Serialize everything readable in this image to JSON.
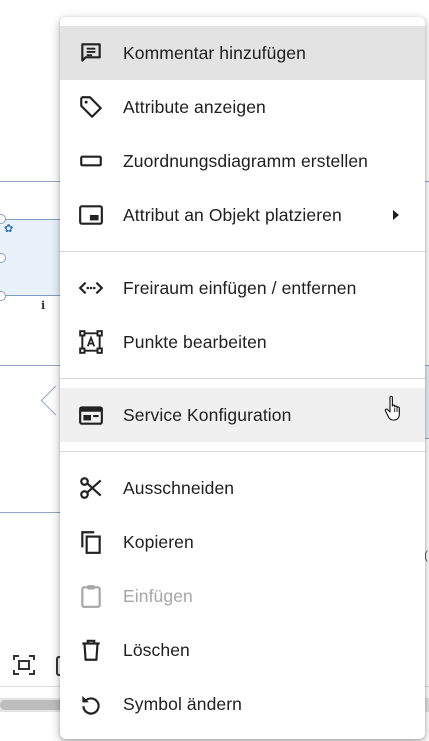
{
  "context_menu": {
    "groups": [
      [
        {
          "label": "Kommentar hinzufügen",
          "icon": "comment-icon",
          "state": "highlighted"
        },
        {
          "label": "Attribute anzeigen",
          "icon": "tag-icon"
        },
        {
          "label": "Zuordnungsdiagramm erstellen",
          "icon": "rectangle-outline-icon"
        },
        {
          "label": "Attribut an Objekt platzieren",
          "icon": "picture-in-picture-icon",
          "submenu": true
        }
      ],
      [
        {
          "label": "Freiraum einfügen / entfernen",
          "icon": "code-arrows-icon"
        },
        {
          "label": "Punkte bearbeiten",
          "icon": "text-frame-icon"
        }
      ],
      [
        {
          "label": "Service Konfiguration",
          "icon": "service-config-icon",
          "state": "hovered"
        }
      ],
      [
        {
          "label": "Ausschneiden",
          "icon": "scissors-icon"
        },
        {
          "label": "Kopieren",
          "icon": "copy-icon"
        },
        {
          "label": "Einfügen",
          "icon": "clipboard-icon",
          "state": "disabled"
        },
        {
          "label": "Löschen",
          "icon": "trash-icon"
        },
        {
          "label": "Symbol ändern",
          "icon": "rotate-icon"
        }
      ]
    ]
  },
  "background": {
    "info_glyph": "i",
    "right_edge_text": "("
  },
  "colors": {
    "menu_background": "#ffffff",
    "highlight": "#e3e3e3",
    "hover": "#f0f0f0",
    "text": "#202020",
    "disabled_text": "#a6a6a6",
    "canvas_line": "#8fa7c7",
    "node_fill": "#e9f1fb"
  }
}
